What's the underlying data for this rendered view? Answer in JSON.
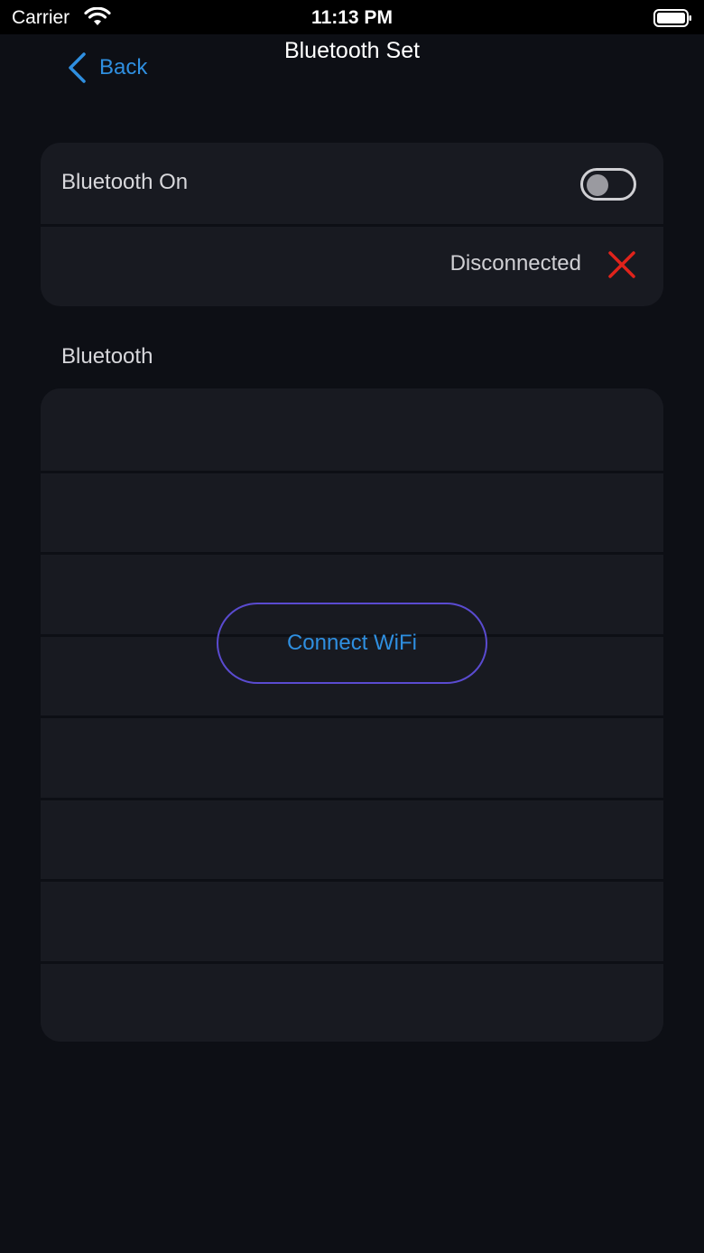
{
  "status_bar": {
    "carrier": "Carrier",
    "time": "11:13 PM",
    "icons": [
      "wifi-icon",
      "battery-icon"
    ]
  },
  "nav": {
    "back_label": "Back",
    "title": "Bluetooth Set"
  },
  "bluetooth_card": {
    "toggle_label": "Bluetooth On",
    "toggle_state": "off",
    "connection_status": "Disconnected",
    "status_icon": "close-icon"
  },
  "device_section": {
    "header": "Bluetooth",
    "rows": [
      "",
      "",
      "",
      "",
      "",
      "",
      "",
      ""
    ]
  },
  "connect_button": {
    "label": "Connect WiFi"
  },
  "colors": {
    "accent": "#2f8fe0",
    "background": "#0d0f15",
    "card": "#181a21",
    "error": "#e0231b",
    "button_border": "#5a4bd0"
  }
}
